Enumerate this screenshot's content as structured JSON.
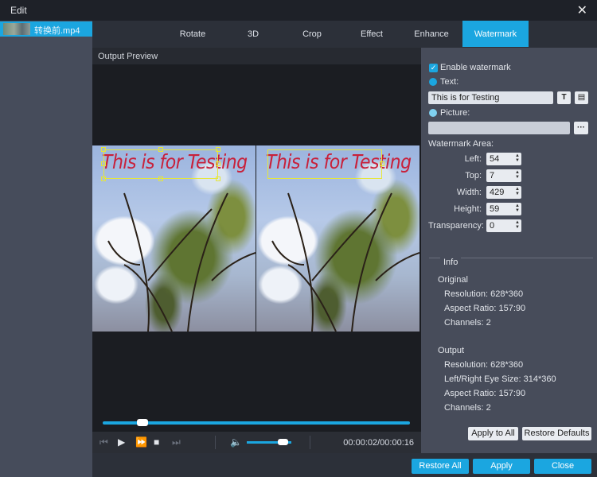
{
  "window": {
    "title": "Edit",
    "close_glyph": "✕"
  },
  "files": [
    {
      "name": "转换前.mp4"
    }
  ],
  "tabs": [
    {
      "label": "Rotate"
    },
    {
      "label": "3D"
    },
    {
      "label": "Crop"
    },
    {
      "label": "Effect"
    },
    {
      "label": "Enhance"
    },
    {
      "label": "Watermark",
      "active": true
    }
  ],
  "preview": {
    "header": "Output Preview",
    "watermark_text": "This is for Testing",
    "seek_progress": 0.13,
    "volume_level": 0.82,
    "timecode": "00:00:02/00:00:16"
  },
  "watermark": {
    "enable_label": "Enable watermark",
    "enabled": true,
    "text_label": "Text:",
    "text_value": "This is for Testing",
    "text_icon": "T",
    "text_style_icon": "folder-icon",
    "picture_label": "Picture:",
    "picture_value": "",
    "browse_label": "···",
    "area_label": "Watermark Area:",
    "left_label": "Left:",
    "left_value": "54",
    "top_label": "Top:",
    "top_value": "7",
    "width_label": "Width:",
    "width_value": "429",
    "height_label": "Height:",
    "height_value": "59",
    "transparency_label": "Transparency:",
    "transparency_value": "0"
  },
  "info": {
    "title": "Info",
    "original_title": "Original",
    "original": [
      "Resolution: 628*360",
      "Aspect Ratio: 157:90",
      "Channels: 2"
    ],
    "output_title": "Output",
    "output": [
      "Resolution: 628*360",
      "Left/Right Eye Size: 314*360",
      "Aspect Ratio: 157:90",
      "Channels: 2"
    ]
  },
  "buttons": {
    "apply_all": "Apply to All",
    "restore_defaults": "Restore Defaults",
    "restore_all": "Restore All",
    "apply": "Apply",
    "close": "Close"
  },
  "colors": {
    "accent": "#1ba6e0",
    "watermark_text": "#c8203a"
  }
}
